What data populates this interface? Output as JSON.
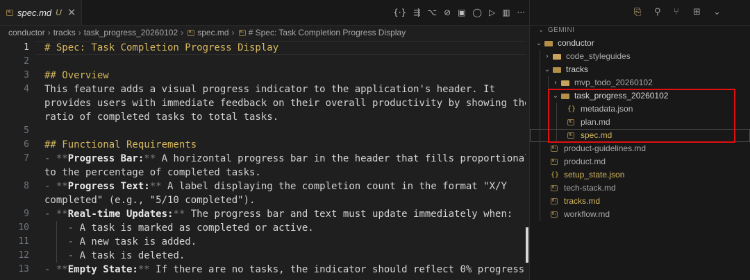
{
  "tab": {
    "title": "spec.md",
    "status": "U",
    "close": "✕",
    "badge": "M↓"
  },
  "actions": [
    "{·}",
    "⇶",
    "⌥",
    "⊘",
    "▣",
    "◯",
    "▷",
    "▥",
    "···"
  ],
  "breadcrumb": [
    "conductor",
    "tracks",
    "task_progress_20260102",
    "spec.md",
    "# Spec: Task Completion Progress Display"
  ],
  "lines": [
    {
      "n": "1",
      "segs": [
        {
          "t": "# Spec: Task Completion Progress Display",
          "c": "h"
        }
      ]
    },
    {
      "n": "2",
      "segs": []
    },
    {
      "n": "3",
      "segs": [
        {
          "t": "## Overview",
          "c": "h"
        }
      ]
    },
    {
      "n": "4",
      "segs": [
        {
          "t": "This feature adds a visual progress indicator to the application's header. It",
          "c": ""
        }
      ]
    },
    {
      "n": "",
      "segs": [
        {
          "t": "provides users with immediate feedback on their overall productivity by showing the",
          "c": ""
        }
      ]
    },
    {
      "n": "",
      "segs": [
        {
          "t": "ratio of completed tasks to total tasks.",
          "c": ""
        }
      ]
    },
    {
      "n": "5",
      "segs": []
    },
    {
      "n": "6",
      "segs": [
        {
          "t": "## Functional Requirements",
          "c": "h"
        }
      ]
    },
    {
      "n": "7",
      "segs": [
        {
          "t": "- ",
          "c": "dash"
        },
        {
          "t": "**",
          "c": "ast"
        },
        {
          "t": "Progress Bar:",
          "c": "bold"
        },
        {
          "t": "**",
          "c": "ast"
        },
        {
          "t": " A horizontal progress bar in the header that fills proportionally",
          "c": ""
        }
      ]
    },
    {
      "n": "",
      "segs": [
        {
          "t": "to the percentage of completed tasks.",
          "c": ""
        }
      ]
    },
    {
      "n": "8",
      "segs": [
        {
          "t": "- ",
          "c": "dash"
        },
        {
          "t": "**",
          "c": "ast"
        },
        {
          "t": "Progress Text:",
          "c": "bold"
        },
        {
          "t": "**",
          "c": "ast"
        },
        {
          "t": " A label displaying the completion count in the format \"X/Y",
          "c": ""
        }
      ]
    },
    {
      "n": "",
      "segs": [
        {
          "t": "completed\" (e.g., \"5/10 completed\").",
          "c": ""
        }
      ]
    },
    {
      "n": "9",
      "segs": [
        {
          "t": "- ",
          "c": "dash"
        },
        {
          "t": "**",
          "c": "ast"
        },
        {
          "t": "Real-time Updates:",
          "c": "bold"
        },
        {
          "t": "**",
          "c": "ast"
        },
        {
          "t": " The progress bar and text must update immediately when:",
          "c": ""
        }
      ]
    },
    {
      "n": "10",
      "segs": [
        {
          "t": "    - ",
          "c": "dash"
        },
        {
          "t": "A task is marked as completed or active.",
          "c": ""
        }
      ]
    },
    {
      "n": "11",
      "segs": [
        {
          "t": "    - ",
          "c": "dash"
        },
        {
          "t": "A new task is added.",
          "c": ""
        }
      ]
    },
    {
      "n": "12",
      "segs": [
        {
          "t": "    - ",
          "c": "dash"
        },
        {
          "t": "A task is deleted.",
          "c": ""
        }
      ]
    },
    {
      "n": "13",
      "segs": [
        {
          "t": "- ",
          "c": "dash"
        },
        {
          "t": "**",
          "c": "ast"
        },
        {
          "t": "Empty State:",
          "c": "bold"
        },
        {
          "t": "**",
          "c": "ast"
        },
        {
          "t": " If there are no tasks, the indicator should reflect 0% progress",
          "c": ""
        }
      ]
    }
  ],
  "activity_icons": [
    "⎘",
    "⚲",
    "⑂",
    "⊞",
    "⌄"
  ],
  "explorer_title": "GEMINI",
  "tree": [
    {
      "label": "conductor",
      "kind": "folder",
      "depth": 0,
      "open": true,
      "color": "#d9d9d9"
    },
    {
      "label": "code_styleguides",
      "kind": "folder",
      "depth": 1,
      "open": false,
      "color": "#a9a9a9"
    },
    {
      "label": "tracks",
      "kind": "folder",
      "depth": 1,
      "open": true,
      "color": "#d9d9d9"
    },
    {
      "label": "mvp_todo_20260102",
      "kind": "folder",
      "depth": 2,
      "open": false,
      "color": "#a9a9a9"
    },
    {
      "label": "task_progress_20260102",
      "kind": "folder",
      "depth": 2,
      "open": true,
      "color": "#d9d9d9"
    },
    {
      "label": "metadata.json",
      "kind": "json",
      "depth": 3,
      "color": "#bdbdbd"
    },
    {
      "label": "plan.md",
      "kind": "md",
      "depth": 3,
      "color": "#bdbdbd"
    },
    {
      "label": "spec.md",
      "kind": "md",
      "depth": 3,
      "color": "#d7b85f",
      "selected": true
    },
    {
      "label": "product-guidelines.md",
      "kind": "md",
      "depth": 1,
      "color": "#a9a9a9"
    },
    {
      "label": "product.md",
      "kind": "md",
      "depth": 1,
      "color": "#a9a9a9"
    },
    {
      "label": "setup_state.json",
      "kind": "json",
      "depth": 1,
      "color": "#d7b85f"
    },
    {
      "label": "tech-stack.md",
      "kind": "md",
      "depth": 1,
      "color": "#a9a9a9"
    },
    {
      "label": "tracks.md",
      "kind": "md",
      "depth": 1,
      "color": "#d7b85f"
    },
    {
      "label": "workflow.md",
      "kind": "md",
      "depth": 1,
      "color": "#a9a9a9"
    }
  ]
}
